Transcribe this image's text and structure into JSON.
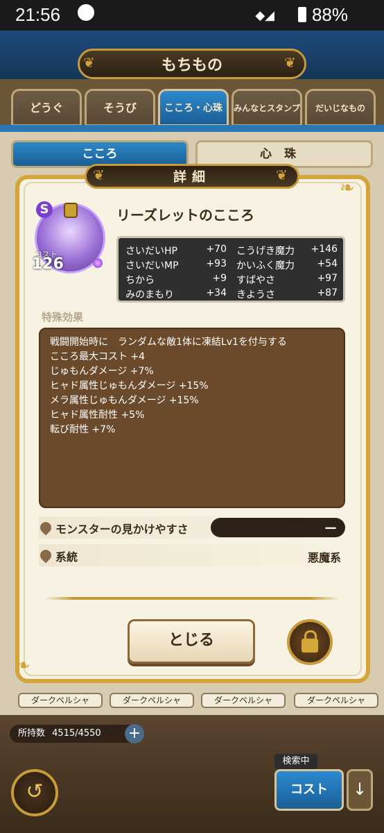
{
  "status_bar": {
    "time": "21:56",
    "battery": "88%"
  },
  "header": {
    "title": "もちもの"
  },
  "tabs": [
    {
      "label": "どうぐ"
    },
    {
      "label": "そうび"
    },
    {
      "label": "こころ・心珠"
    },
    {
      "label": "みんなとスタンプ"
    },
    {
      "label": "だいじなもの"
    }
  ],
  "subtabs": [
    {
      "label": "こころ"
    },
    {
      "label": "心珠"
    }
  ],
  "detail": {
    "title": "詳細",
    "rank": "S",
    "cost_label": "コスト",
    "cost_value": "126",
    "name": "リーズレットのこころ",
    "stats": [
      {
        "key": "さいだいHP",
        "value": "+70"
      },
      {
        "key": "こうげき魔力",
        "value": "+146"
      },
      {
        "key": "さいだいMP",
        "value": "+93"
      },
      {
        "key": "かいふく魔力",
        "value": "+54"
      },
      {
        "key": "ちから",
        "value": "+9"
      },
      {
        "key": "すばやさ",
        "value": "+97"
      },
      {
        "key": "みのまもり",
        "value": "+34"
      },
      {
        "key": "きようさ",
        "value": "+87"
      }
    ],
    "special_label": "特殊効果",
    "effects": [
      "戦闘開始時に　ランダムな敵1体に凍結Lv1を付与する",
      "こころ最大コスト +4",
      "じゅもんダメージ +7%",
      "ヒャド属性じゅもんダメージ +15%",
      "メラ属性じゅもんダメージ +15%",
      "ヒャド属性耐性 +5%",
      "転び耐性 +7%"
    ],
    "visibility_label": "モンスターの見かけやすさ",
    "visibility_value": "ー",
    "family_label": "系統",
    "family_value": "悪魔系",
    "close_label": "とじる"
  },
  "background_items": [
    "ダークペルシャ",
    "ダークペルシャ",
    "ダークペルシャ",
    "ダークペルシャ"
  ],
  "footer": {
    "count_label": "所持数",
    "count_value": "4515/4550",
    "plus": "+",
    "search_tag": "検索中",
    "sort_label": "コスト",
    "back_icon": "↺",
    "sort_dir_icon": "↓"
  }
}
